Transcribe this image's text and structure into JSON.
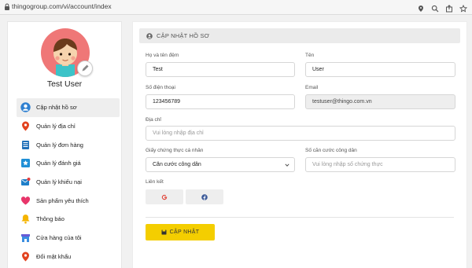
{
  "browser": {
    "url": "thingogroup.com/vi/account/index"
  },
  "profile": {
    "name": "Test User"
  },
  "menu": [
    {
      "label": "Cập nhật hồ sơ",
      "icon": "user-circle-icon",
      "active": true
    },
    {
      "label": "Quản lý địa chỉ",
      "icon": "map-pin-icon"
    },
    {
      "label": "Quản lý đơn hàng",
      "icon": "order-list-icon"
    },
    {
      "label": "Quản lý đánh giá",
      "icon": "star-review-icon"
    },
    {
      "label": "Quản lý khiếu nại",
      "icon": "complaint-mail-icon"
    },
    {
      "label": "Sản phẩm yêu thích",
      "icon": "heart-icon"
    },
    {
      "label": "Thông báo",
      "icon": "bell-icon"
    },
    {
      "label": "Cửa hàng của tôi",
      "icon": "store-icon"
    },
    {
      "label": "Đổi mật khẩu",
      "icon": "key-pin-icon"
    }
  ],
  "panel": {
    "title": "CẬP NHẬT HỒ SƠ"
  },
  "form": {
    "lastname_label": "Họ và tên đệm",
    "lastname_value": "Test",
    "firstname_label": "Tên",
    "firstname_value": "User",
    "phone_label": "Số điện thoại",
    "phone_value": "123456789",
    "email_label": "Email",
    "email_value": "testuser@thingo.com.vn",
    "address_label": "Địa chỉ",
    "address_placeholder": "Vui lòng nhập địa chỉ",
    "idtype_label": "Giấy chứng thực cá nhân",
    "idtype_value": "Căn cước công dân",
    "idnumber_label": "Số căn cước công dân",
    "idnumber_placeholder": "Vui lòng nhập số chứng thực",
    "social_label": "Liên kết",
    "save_label": "CẬP NHẬT"
  },
  "colors": {
    "accent": "#f4ce00",
    "avatar_bg": "#ef7777",
    "google": "#e0453a",
    "facebook": "#3b5998"
  }
}
